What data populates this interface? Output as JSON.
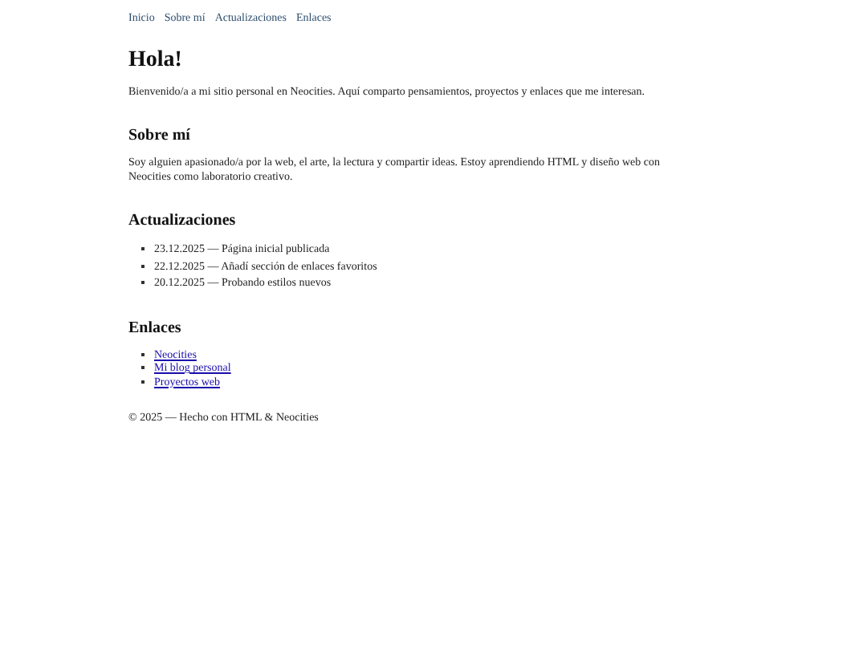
{
  "nav": [
    "Inicio",
    "Sobre mí",
    "Actualizaciones",
    "Enlaces"
  ],
  "title": "Hola!",
  "intro": "Bienvenido/a a mi sitio personal en Neocities. Aquí comparto pensamientos, proyectos y enlaces que me interesan.",
  "about": {
    "heading": "Sobre mí",
    "text": "Soy alguien apasionado/a por la web, el arte, la lectura y compartir ideas. Estoy aprendiendo HTML y diseño web con Neocities como laboratorio creativo."
  },
  "updates": {
    "heading": "Actualizaciones",
    "items": [
      "23.12.2025 — Página inicial publicada",
      "22.12.2025 — Añadí sección de enlaces favoritos",
      "20.12.2025 — Probando estilos nuevos"
    ]
  },
  "links": {
    "heading": "Enlaces",
    "items": [
      "Neocities",
      "Mi blog personal",
      "Proyectos web"
    ]
  },
  "footer": "© 2025 — Hecho con HTML & Neocities"
}
